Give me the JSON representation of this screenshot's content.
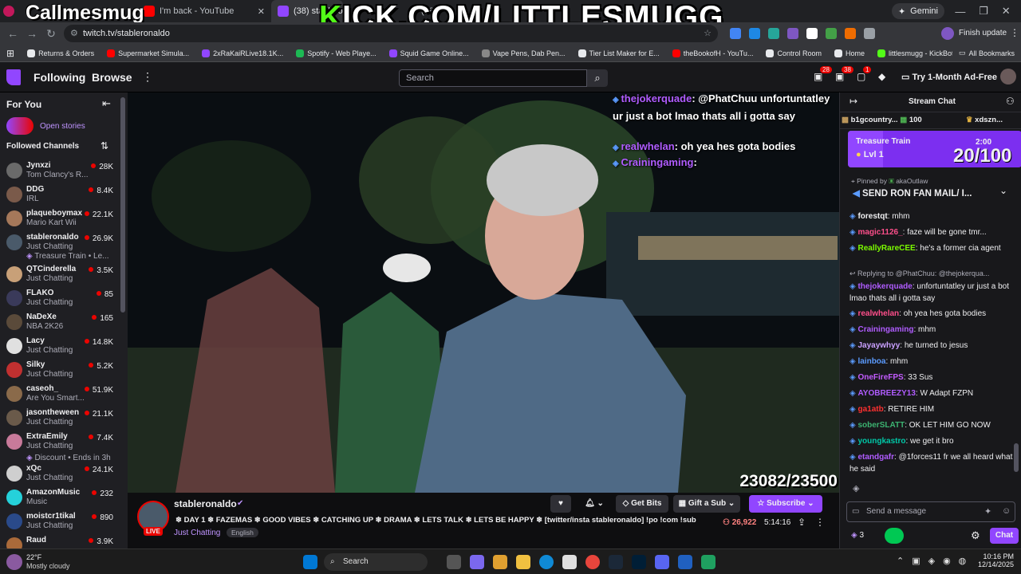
{
  "browser": {
    "tabs": [
      {
        "label": "I'm back - YouTube"
      },
      {
        "label": "(38) stableronaldo"
      },
      {
        "label": "(38)"
      }
    ],
    "gemini": "Gemini",
    "url": "twitch.tv/stableronaldo",
    "finish_update": "Finish update",
    "bookmarks": [
      {
        "label": "Returns & Orders",
        "color": "#e8eaed"
      },
      {
        "label": "Supermarket Simula...",
        "color": "#ff0000"
      },
      {
        "label": "2xRaKaiRLive18.1K...",
        "color": "#9146ff"
      },
      {
        "label": "Spotify - Web Playe...",
        "color": "#1db954"
      },
      {
        "label": "Squid Game Online...",
        "color": "#9146ff"
      },
      {
        "label": "Vape Pens, Dab Pen...",
        "color": "#888888"
      },
      {
        "label": "Tier List Maker for E...",
        "color": "#e8eaed"
      },
      {
        "label": "theBookofH - YouTu...",
        "color": "#ff0000"
      },
      {
        "label": "Control Room",
        "color": "#e8eaed"
      },
      {
        "label": "Home",
        "color": "#e8eaed"
      },
      {
        "label": "littlesmugg - KickBot",
        "color": "#53fc18"
      }
    ],
    "all_bookmarks": "All Bookmarks"
  },
  "overlay": {
    "left_text": "Callmesmug",
    "kick_k": "K",
    "kick_rest": "ICK.COM/LITTLESMUGG"
  },
  "topnav": {
    "following": "Following",
    "browse": "Browse",
    "search_placeholder": "Search",
    "badge_a": "28",
    "badge_b": "38",
    "badge_c": "1",
    "adfree": "Try 1-Month Ad-Free"
  },
  "sidebar": {
    "for_you": "For You",
    "open_stories": "Open stories",
    "followed": "Followed Channels",
    "channels": [
      {
        "name": "Jynxzi",
        "game": "Tom Clancy's R...",
        "viewers": "28K",
        "color": "#6a6a6a"
      },
      {
        "name": "DDG",
        "game": "IRL",
        "viewers": "8.4K",
        "color": "#7a5a4a"
      },
      {
        "name": "plaqueboymax",
        "game": "Mario Kart Wii",
        "viewers": "22.1K",
        "color": "#a5785a"
      },
      {
        "name": "stableronaldo",
        "game": "Just Chatting",
        "viewers": "26.9K",
        "color": "#4a5a6a"
      },
      {
        "name": "QTCinderella",
        "game": "Just Chatting",
        "viewers": "3.5K",
        "color": "#c8a078"
      },
      {
        "name": "FLAKO",
        "game": "Just Chatting",
        "viewers": "85",
        "color": "#3a3a5a"
      },
      {
        "name": "NaDeXe",
        "game": "NBA 2K26",
        "viewers": "165",
        "color": "#5a4a3a"
      },
      {
        "name": "Lacy",
        "game": "Just Chatting",
        "viewers": "14.8K",
        "color": "#e0e0e0"
      },
      {
        "name": "Silky",
        "game": "Just Chatting",
        "viewers": "5.2K",
        "color": "#c03030"
      },
      {
        "name": "caseoh_",
        "game": "Are You Smart...",
        "viewers": "51.9K",
        "color": "#8a6a4a"
      },
      {
        "name": "jasontheween",
        "game": "Just Chatting",
        "viewers": "21.1K",
        "color": "#6a5a4a"
      },
      {
        "name": "ExtraEmily",
        "game": "Just Chatting",
        "viewers": "7.4K",
        "color": "#c87a9a"
      },
      {
        "name": "xQc",
        "game": "Just Chatting",
        "viewers": "24.1K",
        "color": "#cfcfcf"
      },
      {
        "name": "AmazonMusic",
        "game": "Music",
        "viewers": "232",
        "color": "#25d1da"
      },
      {
        "name": "moistcr1tikal",
        "game": "Just Chatting",
        "viewers": "890",
        "color": "#2a4a8a"
      },
      {
        "name": "Raud",
        "game": "",
        "viewers": "3.9K",
        "color": "#aa6a3a"
      }
    ],
    "train_note": "Treasure Train • Le...",
    "discount_note": "Discount • Ends in 3h"
  },
  "video": {
    "chat_overlay": [
      {
        "user": "thejokerquade",
        "color": "#b05cff",
        "text": ": @PhatChuu unfortuntatley ur just a bot lmao thats all i gotta say"
      },
      {
        "user": "realwhelan",
        "color": "#b05cff",
        "text": ": oh yea hes gota bodies"
      },
      {
        "user": "Crainingaming",
        "color": "#b05cff",
        "text": ":"
      }
    ],
    "goal": "23082/23500"
  },
  "stream": {
    "channel": "stableronaldo",
    "live": "LIVE",
    "title": "❄ DAY 1 ❄ FAZEMAS ❄ GOOD VIBES ❄ CATCHING UP ❄ DRAMA ❄ LETS TALK ❄ LETS BE HAPPY ❄ [twitter/insta stableronaldo] !po !com !sub",
    "category": "Just Chatting",
    "language": "English",
    "viewers": "26,922",
    "uptime": "5:14:16",
    "get_bits": "Get Bits",
    "gift_sub": "Gift a Sub",
    "subscribe": "Subscribe"
  },
  "chat": {
    "title": "Stream Chat",
    "gifters": [
      {
        "user": "b1gcountry...",
        "amount": "100"
      },
      {
        "user": "xdszn...",
        "amount": ""
      }
    ],
    "train_title": "Treasure Train",
    "train_level": "Lvl 1",
    "train_time": "2:00",
    "train_progress": "20/100",
    "train_fraction": 0.2,
    "pinned_by": "Pinned by",
    "pinned_user": "akaOutlaw",
    "pinned_text": "SEND RON FAN MAIL/ I...",
    "replying": "Replying to @PhatChuu: @thejokerqua...",
    "messages": [
      {
        "user": "forestqt",
        "color": "#efeff1",
        "text": ": mhm"
      },
      {
        "user": "magic1126_",
        "color": "#ff4f8b",
        "text": ": faze will be gone tmr..."
      },
      {
        "user": "ReallyRareCEE",
        "color": "#7cfc00",
        "text": ": he's a former cia agent"
      },
      {
        "user": "thejokerquade",
        "color": "#b05cff",
        "text": ": unfortuntatley ur just a bot lmao thats all i gotta say"
      },
      {
        "user": "realwhelan",
        "color": "#ff4f8b",
        "text": ": oh yea hes gota bodies"
      },
      {
        "user": "Crainingaming",
        "color": "#b05cff",
        "text": ": mhm"
      },
      {
        "user": "Jayaywhyy",
        "color": "#c9a0ff",
        "text": ": he turned to jesus"
      },
      {
        "user": "lainboa",
        "color": "#5b9bff",
        "text": ": mhm"
      },
      {
        "user": "OneFireFPS",
        "color": "#c35cff",
        "text": ": 33 Sus"
      },
      {
        "user": "AYOBREEZY13",
        "color": "#b05cff",
        "text": ": W Adapt FZPN"
      },
      {
        "user": "ga1atb",
        "color": "#ff3030",
        "text": ": RETIRE HIM"
      },
      {
        "user": "soberSLATT",
        "color": "#3cb371",
        "text": ": OK LET HIM GO NOW"
      },
      {
        "user": "youngkastro",
        "color": "#00c8a8",
        "text": ": we get it bro"
      },
      {
        "user": "etandgafr",
        "color": "#b05cff",
        "text": ": @1forces11 fr we all heard what he said"
      }
    ],
    "send_placeholder": "Send a message",
    "points": "3",
    "chat_button": "Chat"
  },
  "taskbar": {
    "weather_temp": "22°F",
    "weather_desc": "Mostly cloudy",
    "search": "Search",
    "time": "10:16 PM",
    "date": "12/14/2025"
  }
}
